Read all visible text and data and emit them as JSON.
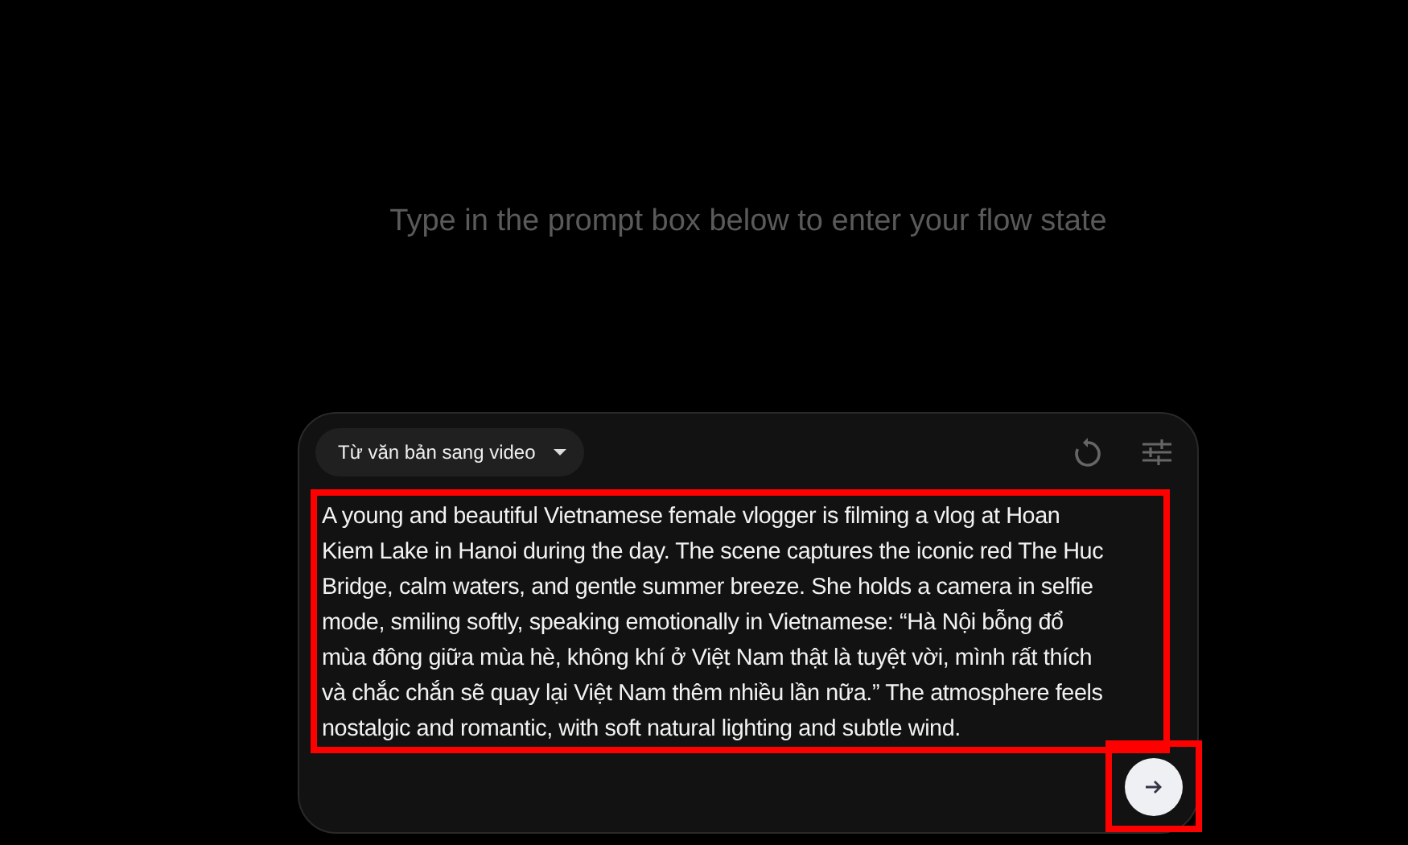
{
  "heading": "Type in the prompt box below to enter your flow state",
  "prompt_box": {
    "mode_dropdown": {
      "label": "Từ văn bản sang video"
    },
    "prompt": {
      "highlighted": true,
      "lines": [
        "A young and beautiful Vietnamese female vlogger is filming a vlog at Hoan",
        "Kiem Lake in Hanoi during the day. The scene captures the iconic red The Huc",
        "Bridge, calm waters, and gentle summer breeze. She holds a camera in selfie",
        "mode, smiling softly, speaking emotionally in Vietnamese: “Hà Nội bỗng đổ",
        "mùa đông giữa mùa hè, không khí ở Việt Nam thật là tuyệt vời, mình rất thích",
        "và chắc chắn sẽ quay lại Việt Nam thêm nhiều lần nữa.” The atmosphere feels",
        "nostalgic and romantic, with soft natural lighting and subtle wind."
      ]
    },
    "send_button": {
      "highlighted": true
    }
  }
}
